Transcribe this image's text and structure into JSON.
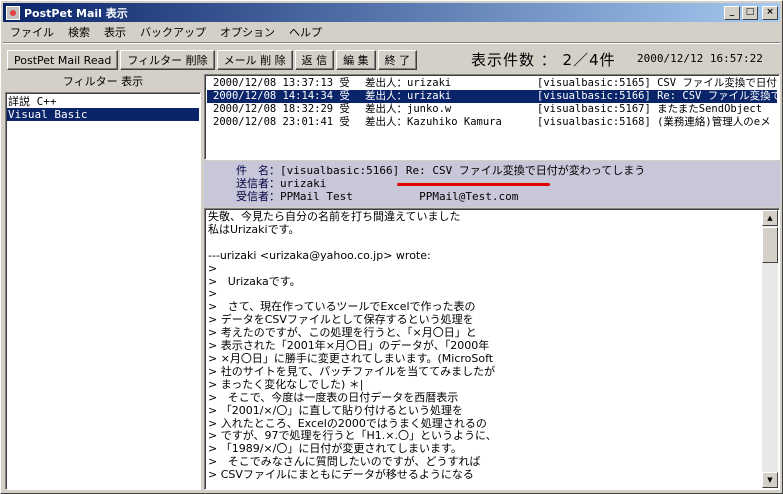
{
  "window": {
    "title": "PostPet Mail 表示"
  },
  "titlebar_buttons": {
    "minimize": "_",
    "maximize": "□",
    "close": "×"
  },
  "menu": [
    "ファイル",
    "検索",
    "表示",
    "バックアップ",
    "オプション",
    "ヘルプ"
  ],
  "toolbar": {
    "buttons": [
      "PostPet Mail Read",
      "フィルター 削除",
      "メール 削 除",
      "返 信",
      "編 集",
      "終 了"
    ],
    "count_label": "表示件数 ： 2／4件",
    "datetime": "2000/12/12  16:57:22"
  },
  "filters": {
    "header": "フィルター 表示",
    "items": [
      "詳説 C++",
      "Visual Basic"
    ],
    "selected_index": 1
  },
  "messages": [
    {
      "date": "2000/12/08 13:37:13 受",
      "from": "差出人：urizaki",
      "subject": "[visualbasic:5165] CSV ファイル変換で日付が",
      "selected": false
    },
    {
      "date": "2000/12/08 14:14:34 受",
      "from": "差出人：urizaki",
      "subject": "[visualbasic:5166] Re: CSV ファイル変換で",
      "selected": true
    },
    {
      "date": "2000/12/08 18:32:29 受",
      "from": "差出人：junko.w",
      "subject": "[visualbasic:5167] またまたSendObject",
      "selected": false
    },
    {
      "date": "2000/12/08 23:01:41 受",
      "from": "差出人：Kazuhiko Kamura",
      "subject": "[visualbasic:5168] (業務連絡)管理人のeメ",
      "selected": false
    }
  ],
  "header": {
    "subject_label": "件　名：",
    "subject": "[visualbasic:5166] Re: CSV ファイル変換で日付が変わってしまう",
    "sender_label": "送信者：",
    "sender": "urizaki",
    "recipient_label": "受信者：",
    "recipient": "PPMail Test          PPMail@Test.com"
  },
  "body": {
    "lines": [
      "失敬、今見たら自分の名前を打ち間違えていました",
      "私はUrizakiです。",
      "",
      "---urizaki <urizaka@yahoo.co.jp> wrote:",
      ">",
      ">   Urizakaです。",
      ">",
      ">   さて、現在作っているツールでExcelで作った表の",
      "> データをCSVファイルとして保存するという処理を",
      "> 考えたのですが、この処理を行うと、「×月〇日」と",
      "> 表示された「2001年×月〇日」のデータが、「2000年",
      "> ×月〇日」に勝手に変更されてしまいます。(MicroSoft",
      "> 社のサイトを見て、パッチファイルを当ててみましたが",
      "> まったく変化なしでした) ＊|",
      ">   そこで、今度は一度表の日付データを西暦表示",
      "> 「2001/×/〇」に直して貼り付けるという処理を",
      "> 入れたところ、Excelの2000ではうまく処理されるの",
      "> ですが、97で処理を行うと「H1.×.〇」というように、",
      "> 「1989/×/〇」に日付が変更されてしまいます。",
      ">   そこでみなさんに質問したいのですが、どうすれば",
      "> CSVファイルにまともにデータが移せるようになる"
    ]
  },
  "colors": {
    "titlebar": "#0a246a",
    "selection": "#0a246a",
    "header_bg": "#c7c7d9",
    "annotation": "#e00000"
  }
}
